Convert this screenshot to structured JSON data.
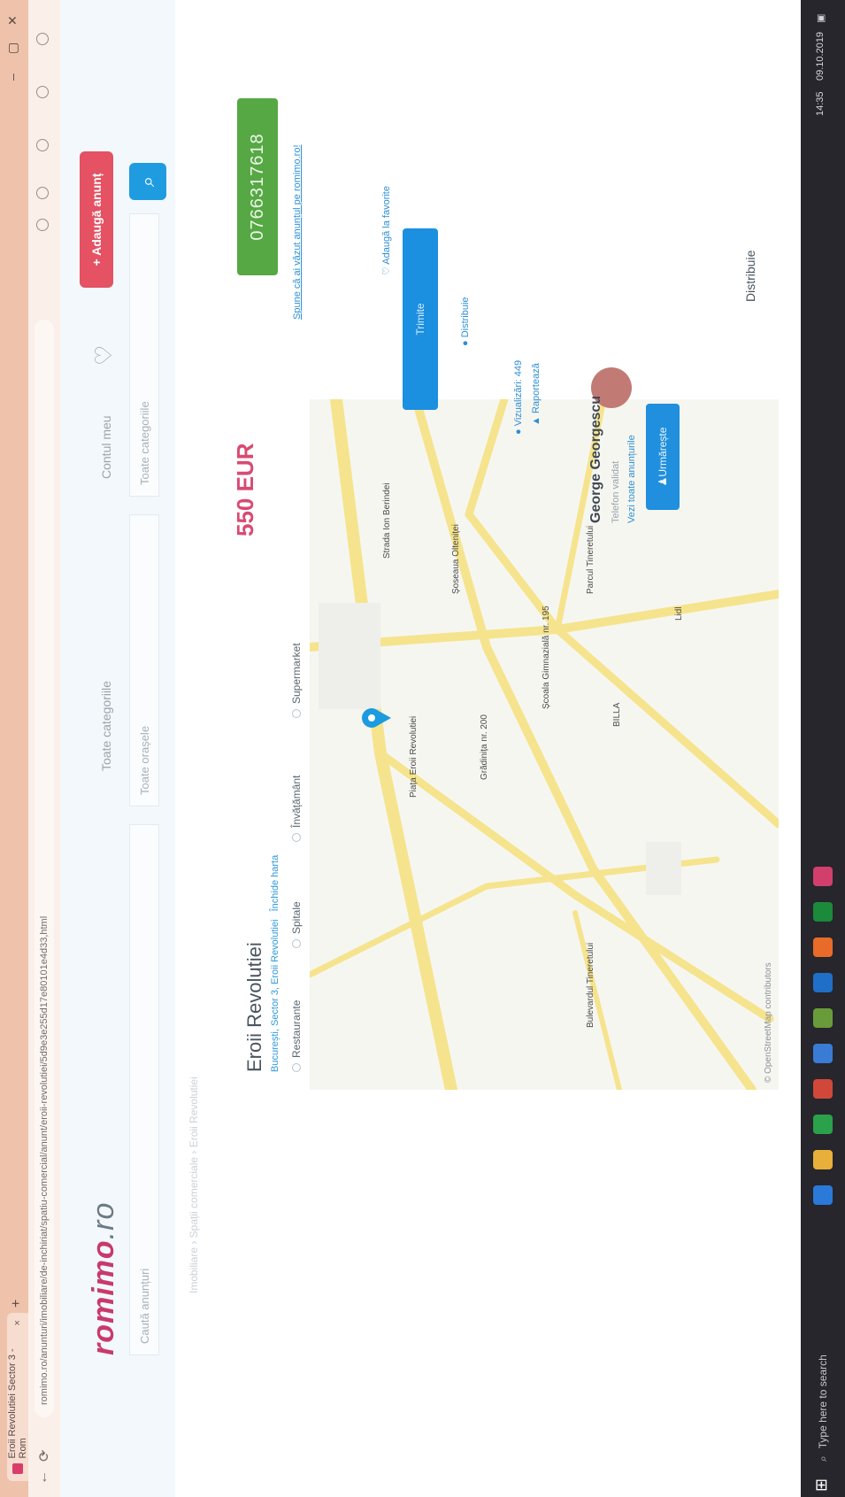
{
  "browser": {
    "tab_title": "Eroii Revolutiei Sector 3 - Rom",
    "tab_close": "×",
    "new_tab": "+",
    "url": "romimo.ro/anunturi/imobiliare/de-inchiriat/spatiu-comercial/anunt/eroii-revolutiei/5d9e3e255d17e80101e4d33,html",
    "win_min": "–",
    "win_max": "▢",
    "win_close": "✕"
  },
  "header": {
    "logo_main": "romimo",
    "logo_tld": ".ro",
    "links": [
      "Toate categoriile",
      "Contul meu"
    ],
    "add_button": "+ Adaugă anunț",
    "search_placeholder": "Caută anunțuri",
    "category_select": "Toate categoriile",
    "location_select": "Toate orașele",
    "search_icon": "search-icon"
  },
  "breadcrumb": "Imobiliare  ›  Spații comerciale  ›  Eroii Revolutiei",
  "listing": {
    "title": "Eroii Revolutiei",
    "address": "București, Sector 3, Eroii Revolutiei",
    "map_link": "Închide harta",
    "price": "550 EUR",
    "phone": "0766317618",
    "phone_note": "Spune că ai văzut anunțul pe romimo.ro!",
    "add_fav": "Adaugă la favorite",
    "send_button": "Trimite",
    "report": "Raportează",
    "share": "Distribuie",
    "views": "Vizualizări: 449"
  },
  "poi_tabs": [
    "Restaurante",
    "Spitale",
    "Învățământ",
    "Supermarket"
  ],
  "map": {
    "labels": [
      "Piața Eroii Revolutiei",
      "Șoseaua Olteniței",
      "Strada Ion Berindei",
      "Bulevardul Tineretului",
      "Grădinița nr. 200",
      "Școala Gimnazială nr. 195",
      "BILLA",
      "Lidl",
      "Parcul Tineretului"
    ],
    "attribution": "© OpenStreetMap contributors"
  },
  "agent": {
    "name": "George Georgescu",
    "role": "Telefon validat",
    "link": "Vezi toate anunțurile",
    "follow": "Urmărește"
  },
  "taskbar": {
    "search": "Type here to search",
    "time": "14:35",
    "date": "09.10.2019"
  }
}
